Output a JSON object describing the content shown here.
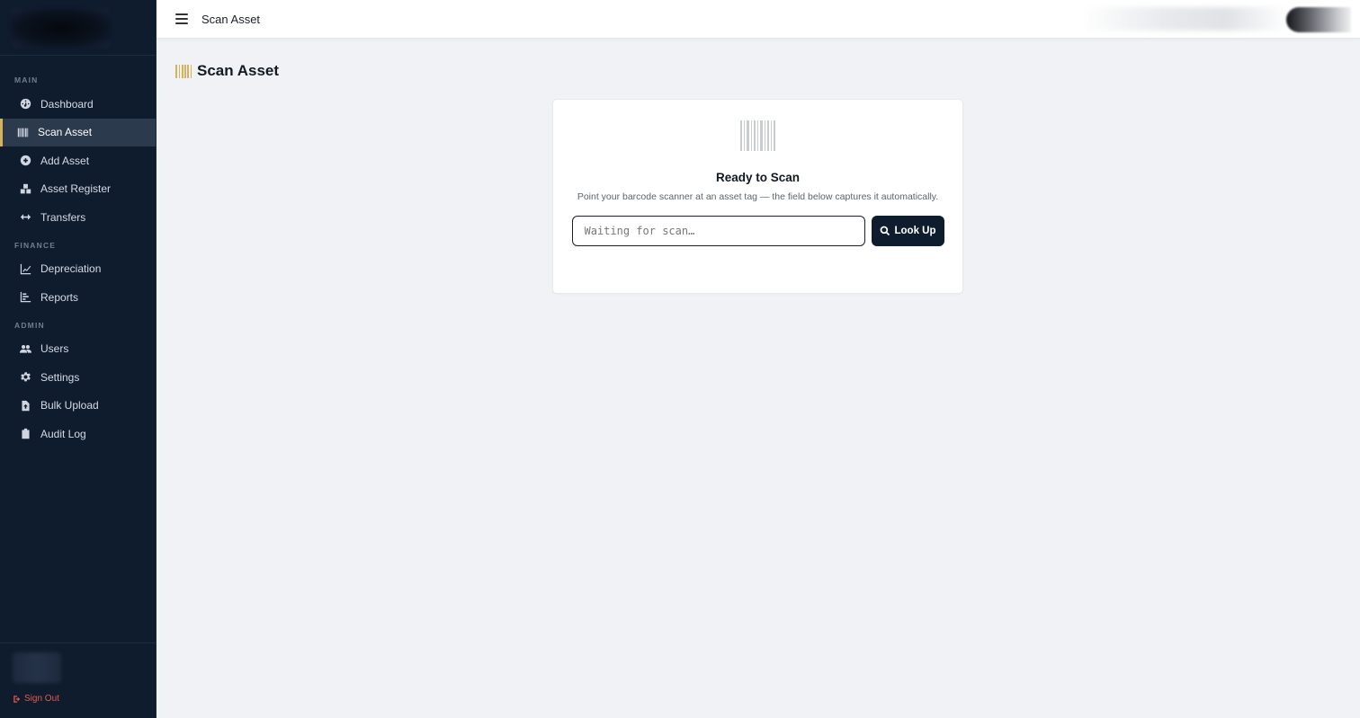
{
  "sidebar": {
    "sections": [
      {
        "label": "MAIN",
        "items": [
          {
            "label": "Dashboard",
            "icon": "dashboard-icon",
            "active": false
          },
          {
            "label": "Scan Asset",
            "icon": "barcode-icon",
            "active": true
          },
          {
            "label": "Add Asset",
            "icon": "plus-circle-icon",
            "active": false
          },
          {
            "label": "Asset Register",
            "icon": "boxes-icon",
            "active": false
          },
          {
            "label": "Transfers",
            "icon": "arrows-horizontal-icon",
            "active": false
          }
        ]
      },
      {
        "label": "FINANCE",
        "items": [
          {
            "label": "Depreciation",
            "icon": "line-chart-icon",
            "active": false
          },
          {
            "label": "Reports",
            "icon": "bar-chart-icon",
            "active": false
          }
        ]
      },
      {
        "label": "ADMIN",
        "items": [
          {
            "label": "Users",
            "icon": "users-icon",
            "active": false
          },
          {
            "label": "Settings",
            "icon": "gear-icon",
            "active": false
          },
          {
            "label": "Bulk Upload",
            "icon": "file-upload-icon",
            "active": false
          },
          {
            "label": "Audit Log",
            "icon": "clipboard-icon",
            "active": false
          }
        ]
      }
    ],
    "signout_label": "Sign Out"
  },
  "topbar": {
    "title": "Scan Asset"
  },
  "page": {
    "title": "Scan Asset"
  },
  "scan_card": {
    "title": "Ready to Scan",
    "subtitle": "Point your barcode scanner at an asset tag — the field below captures it automatically.",
    "input_placeholder": "Waiting for scan…",
    "input_value": "",
    "button_label": "Look Up"
  },
  "colors": {
    "sidebar_bg": "#0f1c2e",
    "accent": "#d6b25e",
    "active_item_bg": "#2c3a4e",
    "page_bg": "#f0f2f5",
    "danger": "#e25a4e"
  }
}
